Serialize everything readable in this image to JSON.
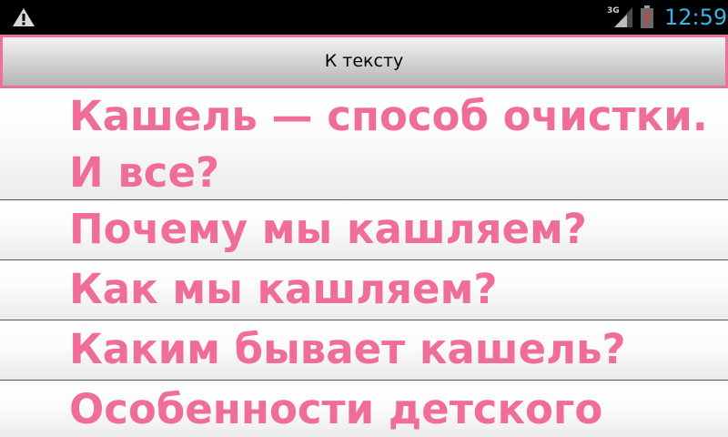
{
  "status_bar": {
    "time": "12:59",
    "network_type": "3G",
    "icons": [
      "warning-icon",
      "signal-icon",
      "battery-icon"
    ],
    "clock_color": "#33b5e5"
  },
  "toolbar": {
    "button_label": "К тексту",
    "border_color": "#f06e9a"
  },
  "list": {
    "text_color": "#ef6d96",
    "items": [
      {
        "line1": "Кашель — способ очистки.",
        "line2": "И все?"
      },
      {
        "line1": "Почему мы кашляем?"
      },
      {
        "line1": "Как мы кашляем?"
      },
      {
        "line1": "Каким бывает кашель?"
      },
      {
        "line1": "Особенности детского"
      }
    ]
  }
}
